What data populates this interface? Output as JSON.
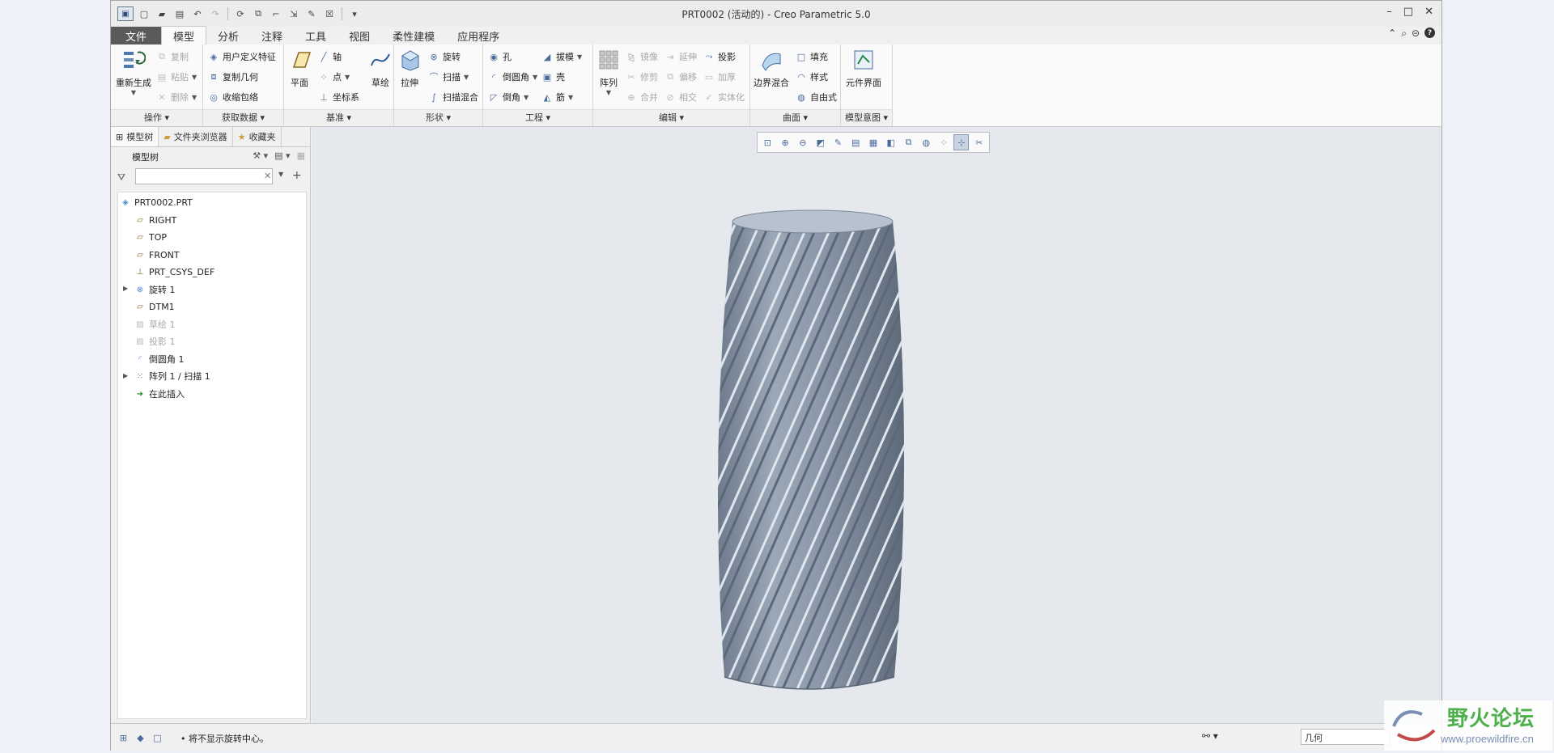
{
  "window": {
    "title": "PRT0002 (活动的) - Creo Parametric 5.0",
    "controls": [
      "–",
      "□",
      "✕"
    ]
  },
  "tabs": [
    {
      "label": "文件"
    },
    {
      "label": "模型"
    },
    {
      "label": "分析"
    },
    {
      "label": "注释"
    },
    {
      "label": "工具"
    },
    {
      "label": "视图"
    },
    {
      "label": "柔性建模"
    },
    {
      "label": "应用程序"
    }
  ],
  "ribbon": {
    "ops": {
      "label": "操作",
      "regen": "重新生成",
      "copy": "复制",
      "paste": "粘贴",
      "delete": "删除"
    },
    "getdata": {
      "label": "获取数据",
      "udf": "用户定义特征",
      "copygeom": "复制几何",
      "shrinkwrap": "收缩包络"
    },
    "datum": {
      "label": "基准",
      "plane": "平面",
      "axis": "轴",
      "point": "点",
      "csys": "坐标系",
      "sketch": "草绘"
    },
    "shapes": {
      "label": "形状",
      "extrude": "拉伸",
      "revolve": "旋转",
      "sweep": "扫描",
      "sweptblend": "扫描混合"
    },
    "eng": {
      "label": "工程",
      "hole": "孔",
      "round": "倒圆角",
      "chamfer": "倒角",
      "draft": "拔模",
      "shell": "壳",
      "rib": "筋"
    },
    "edit": {
      "label": "编辑",
      "pattern": "阵列",
      "mirror": "镜像",
      "trim": "修剪",
      "merge": "合并",
      "extend": "延伸",
      "offset": "偏移",
      "intersect": "相交",
      "project": "投影",
      "thicken": "加厚",
      "solidify": "实体化"
    },
    "surf": {
      "label": "曲面",
      "boundary": "边界混合",
      "fill": "填充",
      "style": "样式",
      "freestyle": "自由式"
    },
    "intent": {
      "label": "模型意图",
      "compiface": "元件界面"
    }
  },
  "leftpane": {
    "tabs": [
      {
        "label": "模型树"
      },
      {
        "label": "文件夹浏览器"
      },
      {
        "label": "收藏夹"
      }
    ],
    "tree_header": "模型树",
    "filter_value": "",
    "nodes": [
      {
        "label": "PRT0002.PRT"
      },
      {
        "label": "RIGHT"
      },
      {
        "label": "TOP"
      },
      {
        "label": "FRONT"
      },
      {
        "label": "PRT_CSYS_DEF"
      },
      {
        "label": "旋转 1"
      },
      {
        "label": "DTM1"
      },
      {
        "label": "草绘 1"
      },
      {
        "label": "投影 1"
      },
      {
        "label": "倒圆角 1"
      },
      {
        "label": "阵列 1 / 扫描 1"
      },
      {
        "label": "在此插入"
      }
    ]
  },
  "status": {
    "message": "• 将不显示旋转中心。",
    "selection_filter": "几何"
  },
  "watermark": {
    "cn": "野火论坛",
    "url": "www.proewildfire.cn"
  }
}
